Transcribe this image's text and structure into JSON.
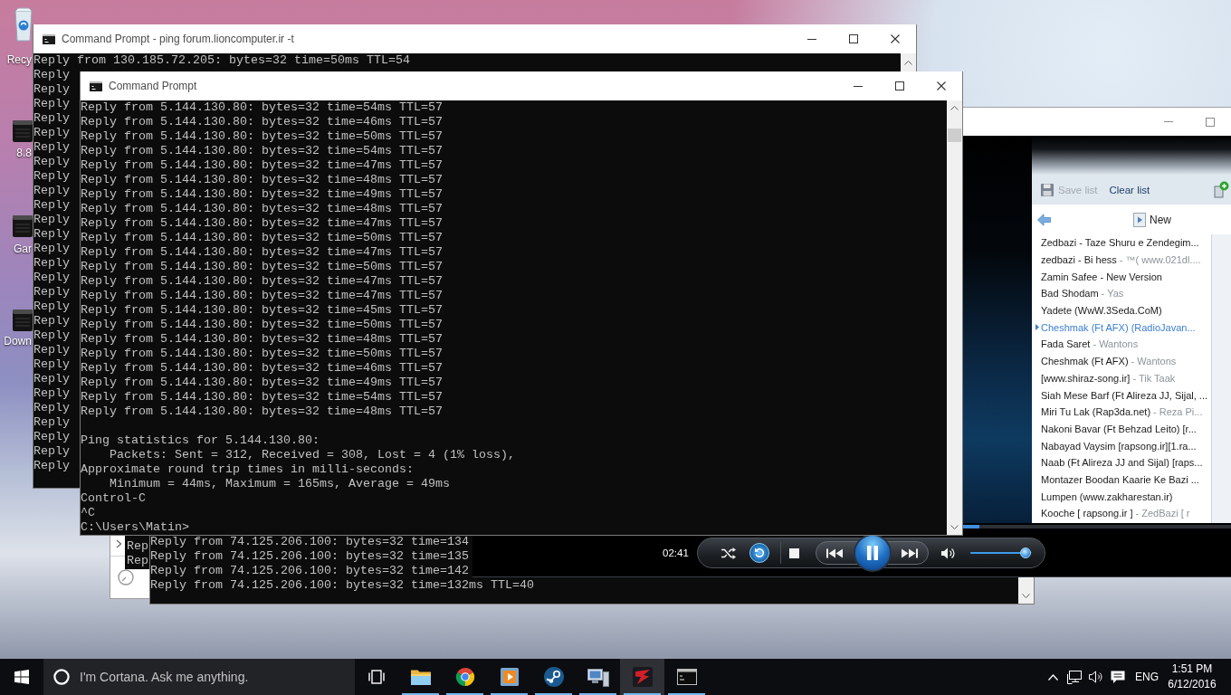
{
  "desktop": {
    "icons": [
      {
        "kind": "recycle-bin",
        "label": "Recy"
      },
      {
        "kind": "drive",
        "label": "8.8"
      },
      {
        "kind": "drive",
        "label": "Gar"
      },
      {
        "kind": "drive",
        "label": "Down"
      }
    ]
  },
  "console_back": {
    "title": "Command Prompt - ping forum.lioncomputer.ir -t",
    "lines": [
      "Reply from 130.185.72.205: bytes=32 time=50ms TTL=54",
      "Reply",
      "Reply",
      "Reply",
      "Reply",
      "Reply",
      "Reply",
      "Reply",
      "Reply",
      "Reply",
      "Reply",
      "Reply",
      "Reply",
      "Reply",
      "Reply",
      "Reply",
      "Reply",
      "Reply",
      "Reply",
      "Reply",
      "Reply",
      "Reply",
      "Reply",
      "Reply",
      "Reply",
      "Reply",
      "Reply",
      "Reply",
      "Reply"
    ]
  },
  "console_front": {
    "title": "Command Prompt",
    "replies": [
      "Reply from 5.144.130.80: bytes=32 time=54ms TTL=57",
      "Reply from 5.144.130.80: bytes=32 time=46ms TTL=57",
      "Reply from 5.144.130.80: bytes=32 time=50ms TTL=57",
      "Reply from 5.144.130.80: bytes=32 time=54ms TTL=57",
      "Reply from 5.144.130.80: bytes=32 time=47ms TTL=57",
      "Reply from 5.144.130.80: bytes=32 time=48ms TTL=57",
      "Reply from 5.144.130.80: bytes=32 time=49ms TTL=57",
      "Reply from 5.144.130.80: bytes=32 time=48ms TTL=57",
      "Reply from 5.144.130.80: bytes=32 time=47ms TTL=57",
      "Reply from 5.144.130.80: bytes=32 time=50ms TTL=57",
      "Reply from 5.144.130.80: bytes=32 time=47ms TTL=57",
      "Reply from 5.144.130.80: bytes=32 time=50ms TTL=57",
      "Reply from 5.144.130.80: bytes=32 time=47ms TTL=57",
      "Reply from 5.144.130.80: bytes=32 time=47ms TTL=57",
      "Reply from 5.144.130.80: bytes=32 time=45ms TTL=57",
      "Reply from 5.144.130.80: bytes=32 time=50ms TTL=57",
      "Reply from 5.144.130.80: bytes=32 time=48ms TTL=57",
      "Reply from 5.144.130.80: bytes=32 time=50ms TTL=57",
      "Reply from 5.144.130.80: bytes=32 time=46ms TTL=57",
      "Reply from 5.144.130.80: bytes=32 time=49ms TTL=57",
      "Reply from 5.144.130.80: bytes=32 time=54ms TTL=57",
      "Reply from 5.144.130.80: bytes=32 time=48ms TTL=57"
    ],
    "summary": [
      {
        "text": "Ping statistics for 5.144.130.80:",
        "indented": false
      },
      {
        "text": "Packets: Sent = 312, Received = 308, Lost = 4 (1% loss),",
        "indented": true
      },
      {
        "text": "Approximate round trip times in milli-seconds:",
        "indented": false
      },
      {
        "text": "Minimum = 44ms, Maximum = 165ms, Average = 49ms",
        "indented": true
      },
      {
        "text": "Control-C",
        "indented": false
      },
      {
        "text": "^C",
        "indented": false
      },
      {
        "text": "C:\\Users\\Matin>",
        "indented": false
      }
    ]
  },
  "console_lower": {
    "lines": [
      "Reply from 74.125.206.100: bytes=32 time=134",
      "Reply from 74.125.206.100: bytes=32 time=135",
      "Reply from 74.125.206.100: bytes=32 time=142",
      "Reply from 74.125.206.100: bytes=32 time=132ms TTL=40"
    ]
  },
  "console_small": {
    "lines": [
      "Rep",
      "Rep"
    ]
  },
  "media_player": {
    "playlist": {
      "toolbar": [
        {
          "kind": "save",
          "label": "Save list",
          "disabled": true
        },
        {
          "kind": "clear",
          "label": "Clear list",
          "disabled": false
        }
      ],
      "heading": "New",
      "items": [
        {
          "title": "Zedbazi - Taze Shuru e Zendegim...",
          "selected": false
        },
        {
          "title": "zedbazi - Bi hess",
          "detail": "- ™( www.021dl....",
          "selected": false
        },
        {
          "title": "Zamin Safee - New Version",
          "selected": false
        },
        {
          "title": "Bad Shodam",
          "detail": "- Yas",
          "selected": false
        },
        {
          "title": "Yadete (WwW.3Seda.CoM)",
          "selected": false
        },
        {
          "title": "Cheshmak (Ft AFX) (RadioJavan...",
          "selected": true
        },
        {
          "title": "Fada Saret",
          "detail": "- Wantons",
          "selected": false
        },
        {
          "title": "Cheshmak (Ft AFX)",
          "detail": "- Wantons",
          "selected": false
        },
        {
          "title": "[www.shiraz-song.ir]",
          "detail": "- Tik Taak",
          "selected": false
        },
        {
          "title": "Siah Mese Barf (Ft Alireza JJ, Sijal, ...",
          "selected": false
        },
        {
          "title": "Miri Tu Lak (Rap3da.net)",
          "detail": "- Reza Pi...",
          "selected": false
        },
        {
          "title": "Nakoni Bavar (Ft Behzad Leito) [r...",
          "selected": false
        },
        {
          "title": "Nabayad Vaysim [rapsong.ir][1.ra...",
          "selected": false
        },
        {
          "title": "Naab (Ft Alireza JJ and Sijal) [raps...",
          "selected": false
        },
        {
          "title": "Montazer Boodan Kaarie Ke Bazi ...",
          "selected": false
        },
        {
          "title": "Lumpen (www.zakharestan.ir)",
          "selected": false
        },
        {
          "title": "Kooche [ rapsong.ir ]",
          "detail": "- ZedBazi [ r",
          "selected": false
        }
      ]
    },
    "seek": {
      "level": 0.06
    },
    "time": "02:41",
    "shuffle": false,
    "repeat": true,
    "playing": true,
    "volume": {
      "level": 0.9
    }
  },
  "taskbar": {
    "search": {
      "placeholder": "I'm Cortana. Ask me anything."
    },
    "apps": [
      {
        "kind": "folder",
        "running": true,
        "active": false
      },
      {
        "kind": "browser",
        "running": true,
        "active": false
      },
      {
        "kind": "media",
        "running": true,
        "active": false
      },
      {
        "kind": "gaming",
        "running": true,
        "active": false
      },
      {
        "kind": "monitor",
        "running": true,
        "active": false
      },
      {
        "kind": "game",
        "running": true,
        "active": true
      },
      {
        "kind": "console",
        "running": true,
        "active": false
      }
    ],
    "language": "ENG",
    "time": "1:51 PM",
    "date": "6/12/2016"
  }
}
